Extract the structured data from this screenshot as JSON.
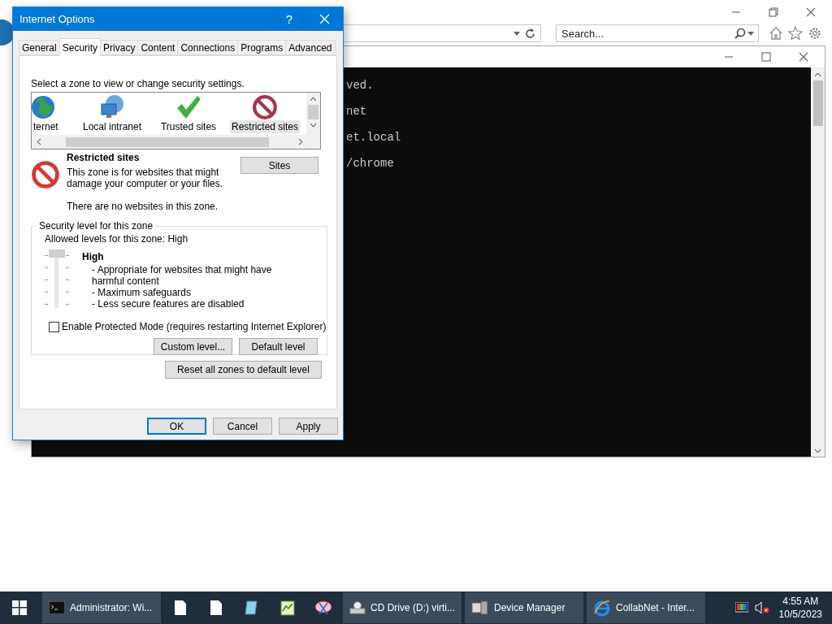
{
  "browser": {
    "search": {
      "placeholder": "Search..."
    }
  },
  "console": {
    "lines": [
      "ved.",
      "net",
      "et.local",
      "/chrome"
    ]
  },
  "dialog": {
    "title": "Internet Options",
    "help": "?",
    "tabs": [
      {
        "label": "General",
        "selected": false
      },
      {
        "label": "Security",
        "selected": true
      },
      {
        "label": "Privacy",
        "selected": false
      },
      {
        "label": "Content",
        "selected": false
      },
      {
        "label": "Connections",
        "selected": false
      },
      {
        "label": "Programs",
        "selected": false
      },
      {
        "label": "Advanced",
        "selected": false
      }
    ],
    "prompt": "Select a zone to view or change security settings.",
    "zones": [
      {
        "label": "ternet",
        "kind": "internet",
        "selected": false
      },
      {
        "label": "Local intranet",
        "kind": "intranet",
        "selected": false
      },
      {
        "label": "Trusted sites",
        "kind": "trusted",
        "selected": false
      },
      {
        "label": "Restricted sites",
        "kind": "restricted",
        "selected": true
      }
    ],
    "zone_title": "Restricted sites",
    "zone_description": "This zone is for websites that might damage your computer or your files.",
    "zone_sites_note": "There are no websites in this zone.",
    "sites_button": "Sites",
    "security": {
      "group_title": "Security level for this zone",
      "allowed": "Allowed levels for this zone: High",
      "level": 1,
      "level_name": "High",
      "details": [
        "- Appropriate for websites that might have harmful content",
        "- Maximum safeguards",
        "- Less secure features are disabled"
      ]
    },
    "protected_mode": {
      "label": "Enable Protected Mode (requires restarting Internet Explorer)",
      "checked": false
    },
    "custom_button": "Custom level...",
    "default_button": "Default level",
    "reset_button": "Reset all zones to default level",
    "buttons": [
      {
        "label": "OK",
        "default": true
      },
      {
        "label": "Cancel",
        "default": false
      },
      {
        "label": "Apply",
        "default": false
      }
    ]
  },
  "taskbar": {
    "items": [
      {
        "label": "Administrator: Wi...",
        "kind": "window"
      },
      {
        "kind": "pinned"
      },
      {
        "kind": "pinned"
      },
      {
        "kind": "pinned"
      },
      {
        "kind": "pinned"
      },
      {
        "kind": "pinned"
      },
      {
        "label": "CD Drive (D:) virti...",
        "kind": "window"
      },
      {
        "label": "Device Manager",
        "kind": "window"
      },
      {
        "label": "CollabNet - Inter...",
        "kind": "window"
      }
    ],
    "time": "4:55 AM",
    "date": "10/5/2023"
  }
}
